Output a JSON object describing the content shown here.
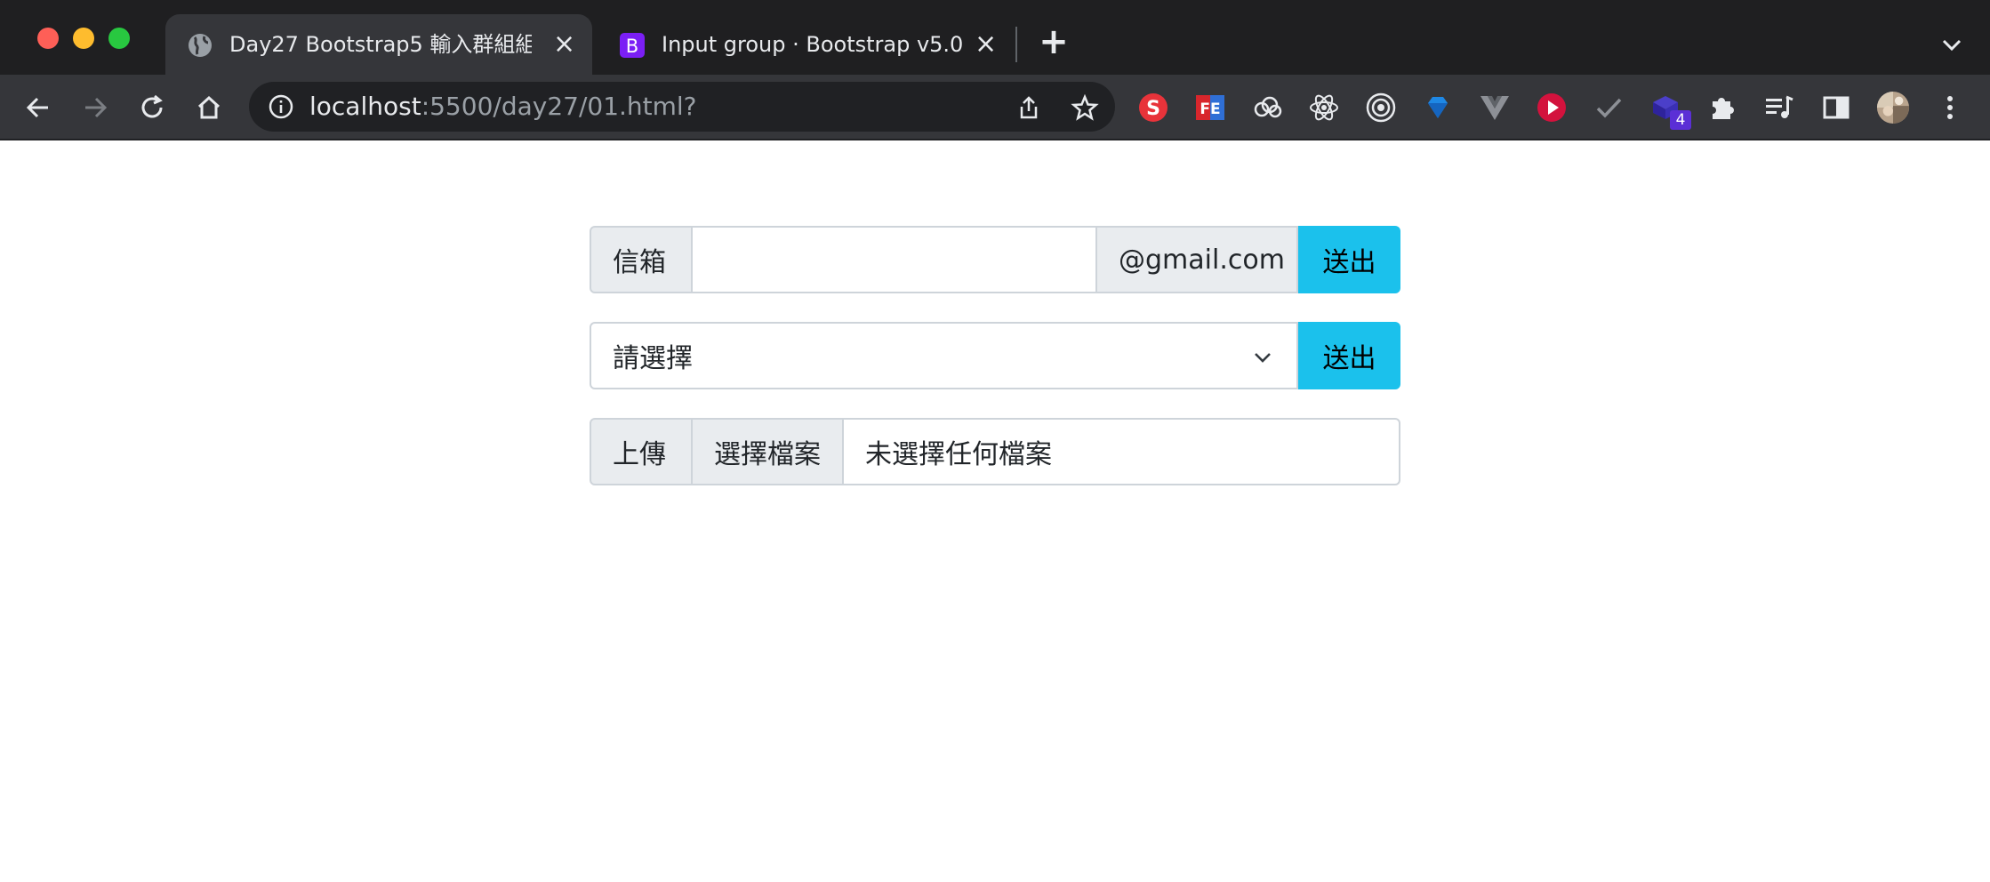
{
  "browser": {
    "tabs": [
      {
        "title": "Day27 Bootstrap5 輸入群組組件",
        "favicon": "globe-icon",
        "active": true
      },
      {
        "title": "Input group · Bootstrap v5.0",
        "favicon": "bootstrap-icon",
        "active": false
      }
    ],
    "url": {
      "host": "localhost",
      "rest": ":5500/day27/01.html?"
    },
    "extensions": [
      "S",
      "FE",
      "cloud",
      "react",
      "target",
      "gem",
      "vue",
      "play",
      "check",
      "box",
      "puzzle",
      "media",
      "sidepanel"
    ],
    "extension_badge": "4",
    "colors": {
      "tabstrip": "#1f1f21",
      "toolbar": "#35363a",
      "omnibox": "#202124"
    }
  },
  "form": {
    "email": {
      "prefix": "信箱",
      "value": "",
      "suffix": "@gmail.com",
      "button": "送出"
    },
    "select": {
      "selected": "請選擇",
      "button": "送出"
    },
    "upload": {
      "prefix": "上傳",
      "choose_button": "選擇檔案",
      "status": "未選擇任何檔案"
    },
    "colors": {
      "addon_bg": "#e9ecef",
      "border": "#ced4da",
      "button": "#1bc1ec"
    }
  }
}
